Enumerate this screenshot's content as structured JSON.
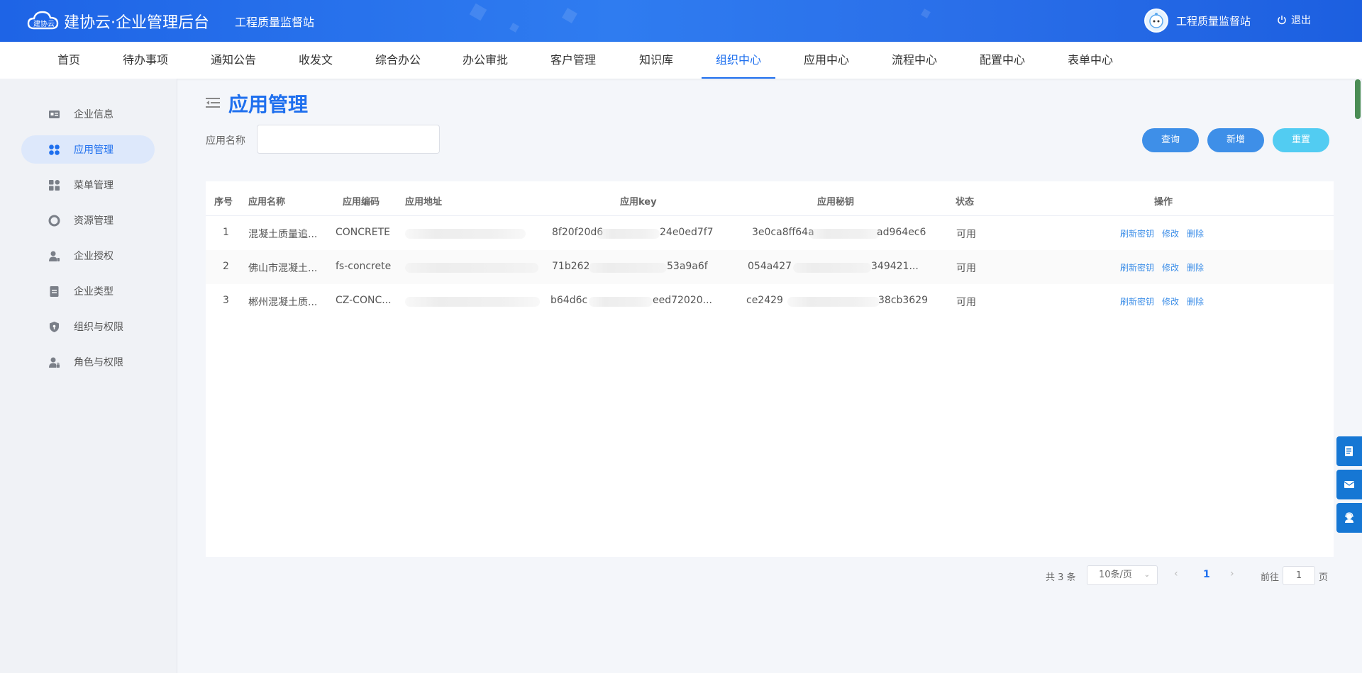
{
  "header": {
    "brand": "建协云·企业管理后台",
    "logo_text": "建协云",
    "sub_brand": "工程质量监督站",
    "user_name": "工程质量监督站",
    "logout": "退出"
  },
  "nav": {
    "items": [
      "首页",
      "待办事项",
      "通知公告",
      "收发文",
      "综合办公",
      "办公审批",
      "客户管理",
      "知识库",
      "组织中心",
      "应用中心",
      "流程中心",
      "配置中心",
      "表单中心"
    ],
    "active_index": 8
  },
  "sidebar": {
    "items": [
      {
        "label": "企业信息",
        "icon": "id-card-icon"
      },
      {
        "label": "应用管理",
        "icon": "apps-grid-icon"
      },
      {
        "label": "菜单管理",
        "icon": "menu-blocks-icon"
      },
      {
        "label": "资源管理",
        "icon": "ring-icon"
      },
      {
        "label": "企业授权",
        "icon": "user-key-icon"
      },
      {
        "label": "企业类型",
        "icon": "document-icon"
      },
      {
        "label": "组织与权限",
        "icon": "shield-icon"
      },
      {
        "label": "角色与权限",
        "icon": "user-lock-icon"
      }
    ],
    "active_index": 1
  },
  "page": {
    "title": "应用管理",
    "filter_label": "应用名称",
    "filter_value": "",
    "buttons": {
      "query": "查询",
      "add": "新增",
      "reset": "重置"
    }
  },
  "table": {
    "columns": [
      "序号",
      "应用名称",
      "应用编码",
      "应用地址",
      "应用key",
      "应用秘钥",
      "状态",
      "操作"
    ],
    "rows": [
      {
        "index": "1",
        "name": "混凝土质量追...",
        "code": "CONCRETE",
        "url": "",
        "key": "8f20f20d6",
        "key_end": "24e0ed7f7",
        "secret": "3e0ca8ff64a",
        "secret_end": "ad964ec6",
        "status": "可用"
      },
      {
        "index": "2",
        "name": "佛山市混凝土...",
        "code": "fs-concrete",
        "url": "",
        "key": "71b262",
        "key_end": "53a9a6f",
        "secret": "054a427",
        "secret_end": "349421...",
        "status": "可用"
      },
      {
        "index": "3",
        "name": "郴州混凝土质...",
        "code": "CZ-CONC...",
        "url": "",
        "key": "b64d6c",
        "key_end": "eed72020...",
        "secret": "ce2429",
        "secret_end": "38cb3629",
        "status": "可用"
      }
    ],
    "actions": [
      "刷新密钥",
      "修改",
      "删除"
    ]
  },
  "pagination": {
    "total": "共 3 条",
    "page_size": "10条/页",
    "current": "1",
    "goto_label": "前往",
    "goto_value": "1",
    "page_suffix": "页"
  },
  "colors": {
    "primary": "#1e6fee",
    "button": "#3e8fe8",
    "reset": "#52ccf2",
    "float": "#1677d4"
  }
}
